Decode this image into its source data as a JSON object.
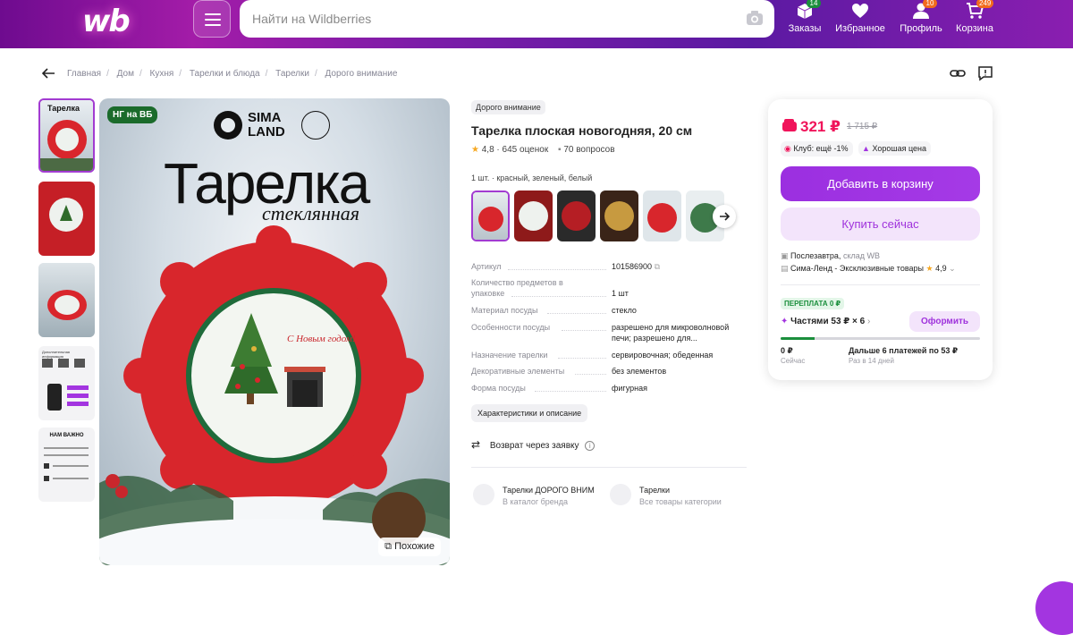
{
  "header": {
    "logo": "wb",
    "search_placeholder": "Найти на Wildberries",
    "nav": [
      {
        "label": "Заказы",
        "badge": "14",
        "icon": "box-icon"
      },
      {
        "label": "Избранное",
        "badge": "",
        "icon": "heart-icon"
      },
      {
        "label": "Профиль",
        "badge": "10",
        "icon": "user-icon"
      },
      {
        "label": "Корзина",
        "badge": "249",
        "icon": "cart-icon"
      }
    ]
  },
  "breadcrumbs": [
    "Главная",
    "Дом",
    "Кухня",
    "Тарелки и блюда",
    "Тарелки",
    "Дорого внимание"
  ],
  "gallery": {
    "badge": "НГ на ВБ",
    "brand_logo": "SIMA LAND",
    "image_title": "Тарелка",
    "image_subtitle": "стеклянная",
    "greeting": "С Новым годом!",
    "similar_label": "Похожие",
    "thumb4_heading": "Дополнительная информация",
    "thumb5_heading": "НАМ ВАЖНО"
  },
  "product": {
    "brand": "Дорого внимание",
    "title": "Тарелка плоская новогодняя, 20 см",
    "rating": "4,8",
    "reviews": "645 оценок",
    "questions": "70 вопросов",
    "variant": "1 шт. · красный, зеленый, белый",
    "specs": [
      {
        "key": "Артикул",
        "value": "101586900"
      },
      {
        "key": "Количество предметов в упаковке",
        "value": "1 шт"
      },
      {
        "key": "Материал посуды",
        "value": "стекло"
      },
      {
        "key": "Особенности посуды",
        "value": "разрешено для микроволновой печи; разрешено для..."
      },
      {
        "key": "Назначение тарелки",
        "value": "сервировочная; обеденная"
      },
      {
        "key": "Декоративные элементы",
        "value": "без элементов"
      },
      {
        "key": "Форма посуды",
        "value": "фигурная"
      }
    ],
    "chars_button": "Характеристики и описание",
    "return_label": "Возврат через заявку",
    "cards": [
      {
        "title": "Тарелки ДОРОГО ВНИМ",
        "subtitle": "В каталог бренда"
      },
      {
        "title": "Тарелки",
        "subtitle": "Все товары категории"
      }
    ]
  },
  "buy": {
    "price": "321 ₽",
    "old_price": "1 715 ₽",
    "club": "Клуб: ещё -1%",
    "good_price": "Хорошая цена",
    "add_to_cart": "Добавить в корзину",
    "buy_now": "Купить сейчас",
    "delivery": "Послезавтра,",
    "warehouse": "склад WB",
    "seller": "Сима-Ленд - Эксклюзивные товары",
    "seller_rating": "4,9",
    "overpay": "ПЕРЕПЛАТА 0 ₽",
    "installments": "Частями 53 ₽ × 6",
    "installments_button": "Оформить",
    "installments_progress": 0.17,
    "pay_now": "0 ₽",
    "pay_now_sub": "Сейчас",
    "pay_later": "Дальше 6 платежей по 53 ₽",
    "pay_later_sub": "Раз в 14 дней"
  },
  "colors": {
    "accent": "#a335e0",
    "price": "#f0145a",
    "green": "#1b8f3c"
  }
}
